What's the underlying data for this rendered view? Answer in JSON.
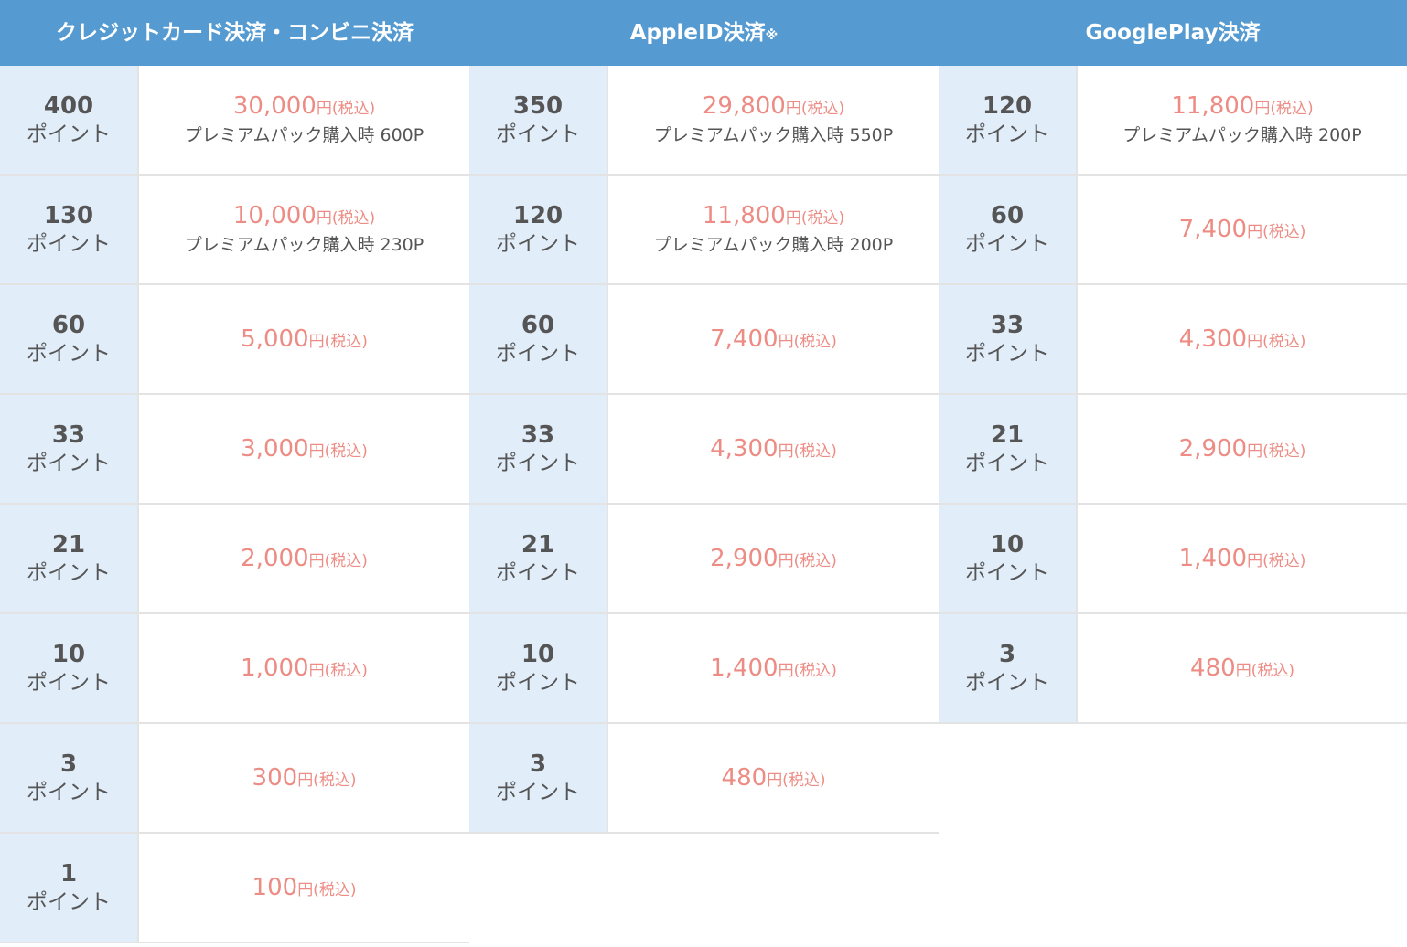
{
  "columns": [
    {
      "title": "クレジットカード決済・コンビニ決済",
      "title_mark": "",
      "rows": [
        {
          "points": "400",
          "unit": "ポイント",
          "price": "30,000",
          "yen": "円(税込)",
          "premium": "プレミアムパック購入時 600P"
        },
        {
          "points": "130",
          "unit": "ポイント",
          "price": "10,000",
          "yen": "円(税込)",
          "premium": "プレミアムパック購入時 230P"
        },
        {
          "points": "60",
          "unit": "ポイント",
          "price": "5,000",
          "yen": "円(税込)",
          "premium": ""
        },
        {
          "points": "33",
          "unit": "ポイント",
          "price": "3,000",
          "yen": "円(税込)",
          "premium": ""
        },
        {
          "points": "21",
          "unit": "ポイント",
          "price": "2,000",
          "yen": "円(税込)",
          "premium": ""
        },
        {
          "points": "10",
          "unit": "ポイント",
          "price": "1,000",
          "yen": "円(税込)",
          "premium": ""
        },
        {
          "points": "3",
          "unit": "ポイント",
          "price": "300",
          "yen": "円(税込)",
          "premium": ""
        },
        {
          "points": "1",
          "unit": "ポイント",
          "price": "100",
          "yen": "円(税込)",
          "premium": ""
        }
      ]
    },
    {
      "title": "AppleID決済",
      "title_mark": "※",
      "rows": [
        {
          "points": "350",
          "unit": "ポイント",
          "price": "29,800",
          "yen": "円(税込)",
          "premium": "プレミアムパック購入時 550P"
        },
        {
          "points": "120",
          "unit": "ポイント",
          "price": "11,800",
          "yen": "円(税込)",
          "premium": "プレミアムパック購入時 200P"
        },
        {
          "points": "60",
          "unit": "ポイント",
          "price": "7,400",
          "yen": "円(税込)",
          "premium": ""
        },
        {
          "points": "33",
          "unit": "ポイント",
          "price": "4,300",
          "yen": "円(税込)",
          "premium": ""
        },
        {
          "points": "21",
          "unit": "ポイント",
          "price": "2,900",
          "yen": "円(税込)",
          "premium": ""
        },
        {
          "points": "10",
          "unit": "ポイント",
          "price": "1,400",
          "yen": "円(税込)",
          "premium": ""
        },
        {
          "points": "3",
          "unit": "ポイント",
          "price": "480",
          "yen": "円(税込)",
          "premium": ""
        }
      ]
    },
    {
      "title": "GooglePlay決済",
      "title_mark": "",
      "rows": [
        {
          "points": "120",
          "unit": "ポイント",
          "price": "11,800",
          "yen": "円(税込)",
          "premium": "プレミアムパック購入時 200P"
        },
        {
          "points": "60",
          "unit": "ポイント",
          "price": "7,400",
          "yen": "円(税込)",
          "premium": ""
        },
        {
          "points": "33",
          "unit": "ポイント",
          "price": "4,300",
          "yen": "円(税込)",
          "premium": ""
        },
        {
          "points": "21",
          "unit": "ポイント",
          "price": "2,900",
          "yen": "円(税込)",
          "premium": ""
        },
        {
          "points": "10",
          "unit": "ポイント",
          "price": "1,400",
          "yen": "円(税込)",
          "premium": ""
        },
        {
          "points": "3",
          "unit": "ポイント",
          "price": "480",
          "yen": "円(税込)",
          "premium": ""
        }
      ]
    }
  ],
  "colors": {
    "header_bg": "#559bd1",
    "points_bg": "#e1edf9",
    "price_text": "#ed8c84",
    "body_text": "#555555",
    "border": "#e3e3e3"
  }
}
